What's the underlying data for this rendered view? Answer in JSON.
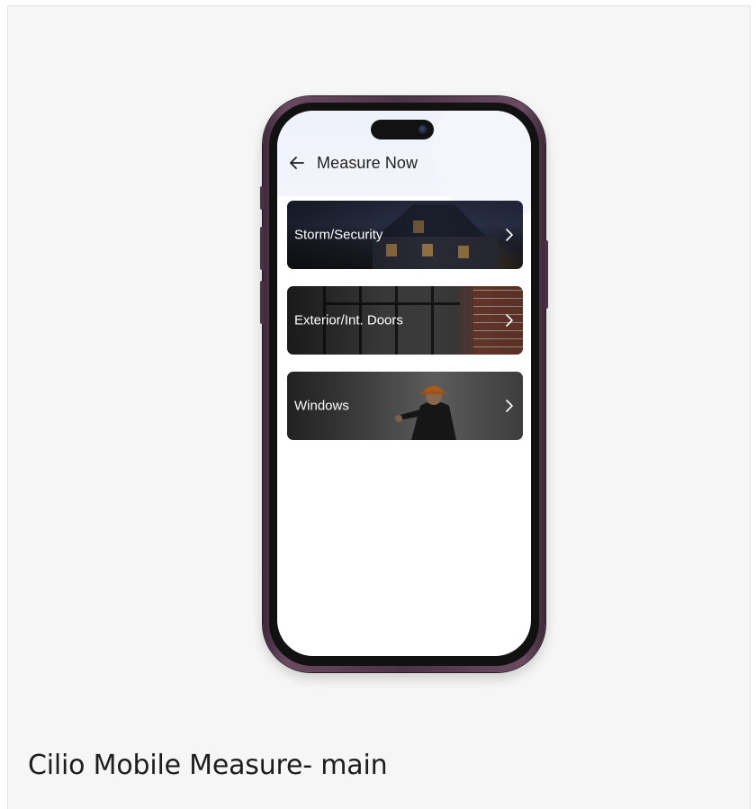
{
  "app": {
    "header": {
      "title": "Measure Now"
    },
    "menu": [
      {
        "label": "Storm/Security",
        "icon": "chevron-right-icon"
      },
      {
        "label": "Exterior/Int. Doors",
        "icon": "chevron-right-icon"
      },
      {
        "label": "Windows",
        "icon": "chevron-right-icon"
      }
    ]
  },
  "caption": "Cilio Mobile Measure- main",
  "colors": {
    "background": "#f6f6f6",
    "phone_frame": "#4c3347",
    "title_text": "#1f1f1f",
    "item_text": "#ffffff"
  }
}
